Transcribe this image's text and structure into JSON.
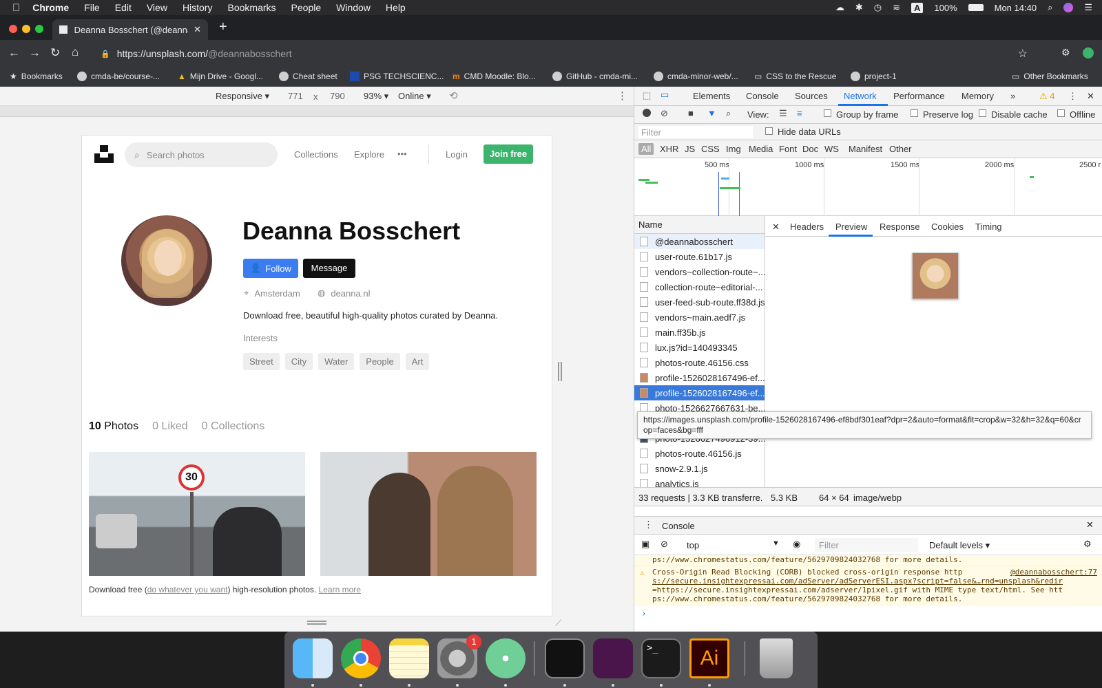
{
  "menubar": {
    "apple": "",
    "app": "Chrome",
    "items": [
      "File",
      "Edit",
      "View",
      "History",
      "Bookmarks",
      "People",
      "Window",
      "Help"
    ],
    "battery": "100%",
    "clock": "Mon 14:40",
    "keyboard": "A"
  },
  "browser": {
    "tab_title": "Deanna Bosschert (@deannabc",
    "url_host": "https://unsplash.com/",
    "url_path": "@deannabosschert",
    "bookmarks": [
      "Bookmarks",
      "cmda-be/course-...",
      "Mijn Drive - Googl...",
      "Cheat sheet",
      "PSG TECHSCIENC...",
      "CMD Moodle: Blo...",
      "GitHub - cmda-mi...",
      "cmda-minor-web/...",
      "CSS to the Rescue",
      "project-1"
    ],
    "other_bookmarks": "Other Bookmarks"
  },
  "device_toolbar": {
    "mode": "Responsive ▾",
    "width": "771",
    "x": "x",
    "height": "790",
    "zoom": "93% ▾",
    "network": "Online ▾"
  },
  "site": {
    "search_placeholder": "Search photos",
    "nav": [
      "Collections",
      "Explore",
      "•••"
    ],
    "login": "Login",
    "join": "Join free",
    "name": "Deanna Bosschert",
    "follow": "Follow",
    "message": "Message",
    "location": "Amsterdam",
    "website": "deanna.nl",
    "bio": "Download free, beautiful high-quality photos curated by Deanna.",
    "interests_label": "Interests",
    "interests": [
      "Street",
      "City",
      "Water",
      "People",
      "Art"
    ],
    "tabs": [
      {
        "count": "10",
        "label": "Photos"
      },
      {
        "count": "0",
        "label": "Liked"
      },
      {
        "count": "0",
        "label": "Collections"
      }
    ],
    "footer_pre": "Download free (",
    "footer_link": "do whatever you want",
    "footer_mid": ") high-resolution photos. ",
    "footer_learn": "Learn more",
    "photo1_sign": "30"
  },
  "devtools": {
    "tabs": [
      "Elements",
      "Console",
      "Sources",
      "Network",
      "Performance",
      "Memory"
    ],
    "more": "»",
    "warnings": "⚠ 4",
    "view_label": "View:",
    "group_by_frame": "Group by frame",
    "preserve_log": "Preserve log",
    "disable_cache": "Disable cache",
    "offline": "Offline",
    "filter_placeholder": "Filter",
    "hide_data_urls": "Hide data URLs",
    "types": [
      "All",
      "XHR",
      "JS",
      "CSS",
      "Img",
      "Media",
      "Font",
      "Doc",
      "WS",
      "Manifest",
      "Other"
    ],
    "timeline_ticks": [
      "500 ms",
      "1000 ms",
      "1500 ms",
      "2000 ms",
      "2500 r"
    ],
    "name_header": "Name",
    "requests": [
      "@deannabosschert",
      "user-route.61b17.js",
      "vendors~collection-route~...",
      "collection-route~editorial-...",
      "user-feed-sub-route.ff38d.js",
      "vendors~main.aedf7.js",
      "main.ff35b.js",
      "lux.js?id=140493345",
      "photos-route.46156.css",
      "profile-1526028167496-ef...",
      "profile-1526028167496-ef...",
      "photo-1526627667631-be...",
      "photo-1526627496912-39...",
      "photos-route.46156.js",
      "snow-2.9.1.js",
      "analytics.js"
    ],
    "tooltip": "https://images.unsplash.com/profile-1526028167496-ef8bdf301eaf?dpr=2&auto=format&fit=crop&w=32&h=32&q=60&crop=faces&bg=fff",
    "preview_tabs": [
      "Headers",
      "Preview",
      "Response",
      "Cookies",
      "Timing"
    ],
    "summary": "33 requests | 3.3 KB transferre...",
    "size": "5.3 KB",
    "dims": "64 × 64",
    "mime": "image/webp",
    "console_title": "Console",
    "context": "top",
    "console_filter": "Filter",
    "levels": "Default levels ▾",
    "log1": "ps://www.chromestatus.com/feature/5629709824032768 for more details.",
    "log2a": "Cross-Origin Read Blocking (CORB) blocked cross-origin response http",
    "log2src": "@deannabosschert:77",
    "log2b": "s://secure.insightexpressai.com/adServer/adServerESI.aspx?script=false&…rnd=unsplash&redir",
    "log2c": "=https://secure.insightexpressai.com/adserver/1pixel.gif with MIME type text/html. See htt",
    "log2d": "ps://www.chromestatus.com/feature/5629709824032768 for more details.",
    "prompt": "›"
  },
  "dock": {
    "badge": "1",
    "ai": "Ai"
  },
  "colors": {
    "follow": "#3b7cf1",
    "join": "#3cb46e",
    "selected": "#3879d9",
    "network_tab": "#1a73e8"
  }
}
